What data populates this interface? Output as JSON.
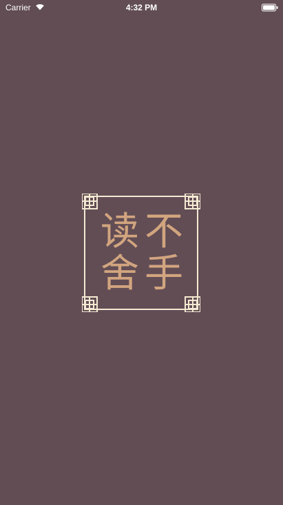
{
  "status_bar": {
    "carrier": "Carrier",
    "time": "4:32 PM"
  },
  "logo": {
    "chars": [
      "读",
      "不",
      "舍",
      "手"
    ]
  },
  "colors": {
    "background": "#624d55",
    "frame": "#f4ead2",
    "characters": "#d2a57f"
  },
  "icons": {
    "wifi": "wifi-icon",
    "battery": "battery-icon"
  }
}
